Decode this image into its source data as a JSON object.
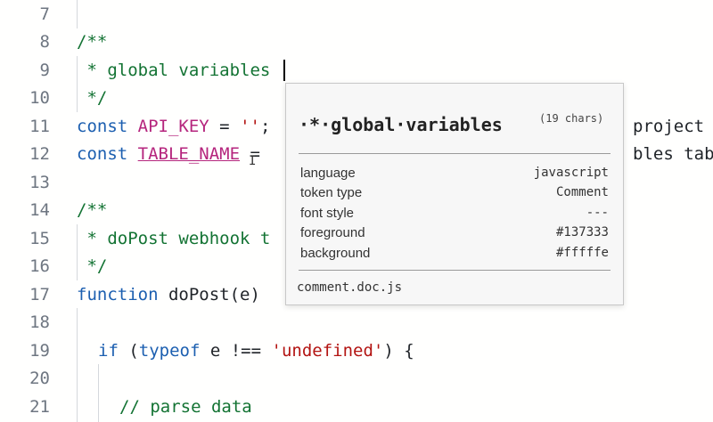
{
  "editor": {
    "line_numbers": [
      "7",
      "8",
      "9",
      "10",
      "11",
      "12",
      "13",
      "14",
      "15",
      "16",
      "17",
      "18",
      "19",
      "20",
      "21"
    ],
    "lines": {
      "l8": "/**",
      "l9": " * global variables",
      "l10": " */",
      "l11_kw": "const",
      "l11_name": "API_KEY",
      "l11_eq": " = ",
      "l11_str": "''",
      "l11_semi": ";",
      "l11_tail": "project",
      "l12_kw": "const",
      "l12_name": "TABLE_NAME",
      "l12_eq": " =",
      "l12_tail": "bles tab",
      "l14": "/**",
      "l15": " * doPost webhook t",
      "l16": " */",
      "l17_kw": "function",
      "l17_rest": " doPost(e)",
      "l19_kw": "if",
      "l19_p1": " (",
      "l19_kw2": "typeof",
      "l19_mid": " e !== ",
      "l19_str": "'undefined'",
      "l19_end": ") {",
      "l21": "// parse data"
    }
  },
  "hover_popup": {
    "title": "·*·global·variables",
    "char_count": "(19 chars)",
    "rows": [
      {
        "label": "language",
        "value": "javascript"
      },
      {
        "label": "token type",
        "value": "Comment"
      },
      {
        "label": "font style",
        "value": "---"
      },
      {
        "label": "foreground",
        "value": "#137333"
      },
      {
        "label": "background",
        "value": "#fffffe"
      }
    ],
    "scope": "comment.doc.js"
  },
  "colors": {
    "comment": "#137333",
    "keyword": "#1c5fb0",
    "constant": "#b5257d",
    "string": "#b31412",
    "background": "#fffffe"
  }
}
